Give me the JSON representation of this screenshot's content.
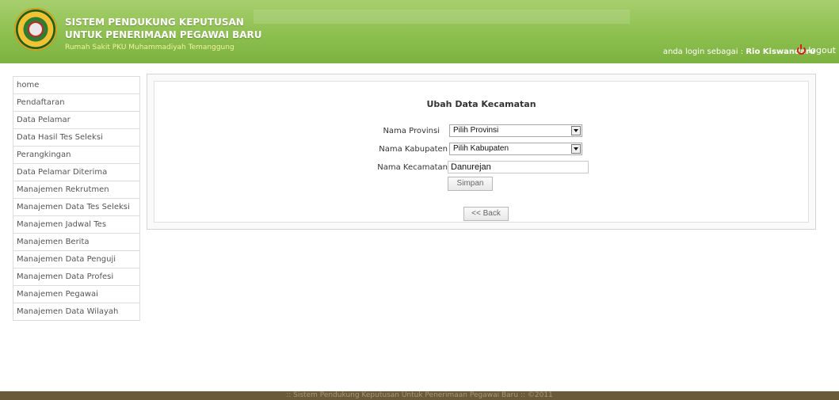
{
  "header": {
    "title_line1": "SISTEM PENDUKUNG KEPUTUSAN",
    "title_line2": "UNTUK PENERIMAAN PEGAWAI BARU",
    "subtitle": "Rumah Sakit PKU Muhammadiyah Temanggung",
    "login_prefix": "anda login sebagai :",
    "user_name": "Rio Kiswandaru",
    "logout_label": "logout",
    "logo_icon": "hospital-logo-icon",
    "logout_icon": "power-icon"
  },
  "sidebar": {
    "items": [
      {
        "label": "home"
      },
      {
        "label": "Pendaftaran"
      },
      {
        "label": "Data Pelamar"
      },
      {
        "label": "Data Hasil Tes Seleksi"
      },
      {
        "label": "Perangkingan"
      },
      {
        "label": "Data Pelamar Diterima"
      },
      {
        "label": "Manajemen Rekrutmen"
      },
      {
        "label": "Manajemen Data Tes Seleksi"
      },
      {
        "label": "Manajemen Jadwal Tes"
      },
      {
        "label": "Manajemen Berita"
      },
      {
        "label": "Manajemen Data Penguji"
      },
      {
        "label": "Manajemen Data Profesi"
      },
      {
        "label": "Manajemen Pegawai"
      },
      {
        "label": "Manajemen Data Wilayah"
      }
    ]
  },
  "form": {
    "title": "Ubah Data Kecamatan",
    "provinsi_label": "Nama Provinsi",
    "provinsi_value": "Pilih Provinsi",
    "kabupaten_label": "Nama Kabupaten",
    "kabupaten_value": "Pilih Kabupaten",
    "kecamatan_label": "Nama Kecamatan",
    "kecamatan_value": "Danurejan",
    "save_label": "Simpan",
    "back_label": "<< Back"
  },
  "footer": {
    "text": ":: Sistem Pendukung Keputusan Untuk Penerimaan Pegawai Baru ::  ©2011"
  },
  "colors": {
    "header_green": "#8dbf4f",
    "footer_brown": "#6a5a3a",
    "logout_red": "#d81f1f"
  }
}
